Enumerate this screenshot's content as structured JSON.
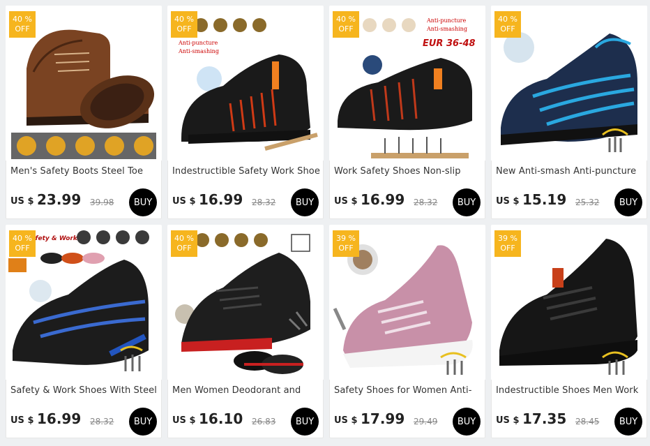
{
  "colors": {
    "badge": "#f6b51e",
    "buy_button": "#000000",
    "background": "#eef0f2"
  },
  "products": [
    {
      "discount": "40 %",
      "off": "OFF",
      "title": "Men's Safety Boots Steel Toe",
      "currency": "US $",
      "price": "23.99",
      "old_price": "39.98",
      "buy": "BUY",
      "image": {
        "icon": "brown-leather-boot-image",
        "overlay_text": []
      }
    },
    {
      "discount": "40 %",
      "off": "OFF",
      "title": "Indestructible Safety Work Shoes",
      "currency": "US $",
      "price": "16.99",
      "old_price": "28.32",
      "buy": "BUY",
      "image": {
        "icon": "black-orange-sneaker-image",
        "overlay_text": [
          "Anti-puncture",
          "Anti-smashing"
        ]
      }
    },
    {
      "discount": "40 %",
      "off": "OFF",
      "title": "Work Safety Shoes Non-slip",
      "currency": "US $",
      "price": "16.99",
      "old_price": "28.32",
      "buy": "BUY",
      "image": {
        "icon": "black-orange-sneaker-image",
        "overlay_text": [
          "Anti-puncture",
          "Anti-smashing",
          "EUR 36-48"
        ]
      }
    },
    {
      "discount": "40 %",
      "off": "OFF",
      "title": "New Anti-smash Anti-puncture",
      "currency": "US $",
      "price": "15.19",
      "old_price": "25.32",
      "buy": "BUY",
      "image": {
        "icon": "blue-sneaker-image",
        "overlay_text": []
      }
    },
    {
      "discount": "40 %",
      "off": "OFF",
      "title": "Safety & Work Shoes With Steel",
      "currency": "US $",
      "price": "16.99",
      "old_price": "28.32",
      "buy": "BUY",
      "image": {
        "icon": "black-blue-sneaker-image",
        "overlay_text": [
          "Safety & Work"
        ]
      }
    },
    {
      "discount": "40 %",
      "off": "OFF",
      "title": "Men Women Deodorant and",
      "currency": "US $",
      "price": "16.10",
      "old_price": "26.83",
      "buy": "BUY",
      "image": {
        "icon": "black-red-sneaker-image",
        "overlay_text": []
      }
    },
    {
      "discount": "39 %",
      "off": "OFF",
      "title": "Safety Shoes for Women Anti-",
      "currency": "US $",
      "price": "17.99",
      "old_price": "29.49",
      "buy": "BUY",
      "image": {
        "icon": "pink-sneaker-image",
        "overlay_text": []
      }
    },
    {
      "discount": "39 %",
      "off": "OFF",
      "title": "Indestructible Shoes Men Work",
      "currency": "US $",
      "price": "17.35",
      "old_price": "28.45",
      "buy": "BUY",
      "image": {
        "icon": "black-sneaker-image",
        "overlay_text": []
      }
    }
  ]
}
